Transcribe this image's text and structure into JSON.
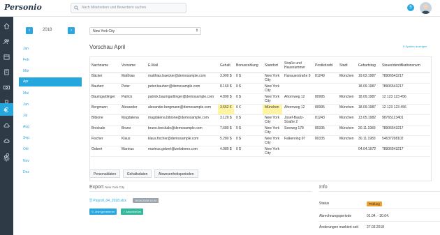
{
  "app": {
    "logo": "Personio",
    "search_placeholder": "Nach Mitarbeitern und Bewerbern suchen",
    "notification_count": "5"
  },
  "sidebar": {
    "icons": [
      "home-icon",
      "users-icon",
      "calendar-icon",
      "building-icon",
      "money-icon",
      "trophy-icon",
      "euro-icon",
      "cloud-upload-icon",
      "cloud-icon",
      "link-icon",
      "gear-icon"
    ],
    "active": "euro-icon"
  },
  "period": {
    "year": "2018",
    "prev_label": "‹",
    "next_label": "›",
    "months": [
      "Jan",
      "Feb",
      "Mär",
      "Apr",
      "Mai",
      "Jun",
      "Jul",
      "Aug",
      "Sep",
      "Okt",
      "Nov",
      "Dez"
    ],
    "active_month": "Apr"
  },
  "main": {
    "location_select": "New York City",
    "preview_title": "Vorschau April",
    "hide_columns_link": "5 Spalten anzeigen",
    "columns": [
      "Nachname",
      "Vorname",
      "E-Mail",
      "Gehalt",
      "Bonuszahlung",
      "Standort",
      "Straße und Hausnummer",
      "Postleitzahl",
      "Stadt",
      "Geburtstag",
      "Steueridentifikationsnum"
    ],
    "rows": [
      [
        "Bäcker",
        "Matthias",
        "matthias.baecker@demosample.com",
        "3.900 $",
        "0 $",
        "New York City",
        "Hanauerstraße 9",
        "81249",
        "München",
        "19.03.1987",
        "78906543217"
      ],
      [
        "Bauherr",
        "Peter",
        "peter.bauherr@demosample.com",
        "8.160 $",
        "0 $",
        "New York City",
        "",
        "",
        "",
        "18.09.1987",
        "78906543217"
      ],
      [
        "Baumgartlinger",
        "Patrick",
        "patrick.baumgartlinger@demosample.com",
        "4.800 $",
        "0 $",
        "New York City",
        "Ahornweg 12",
        "80995",
        "München",
        "18.09.1987",
        "12 123 123 456"
      ],
      [
        "Bergmann",
        "Alexander",
        "alexander.bergmann@demosample.com",
        "3.552 €",
        "0 €",
        "München",
        "Ahornweg 12",
        "80995",
        "München",
        "18.09.1987",
        "12 123 123 456"
      ],
      [
        "Bibione",
        "Magdalena",
        "magdalena.bibione@demosample.com",
        "3.120 $",
        "0 $",
        "New York City",
        "Josef-Bautz-Straße 2",
        "81243",
        "München",
        "13.05.1982",
        "98765123401"
      ],
      [
        "Breckalo",
        "Bruno",
        "bruno.breckalo@demosample.com",
        "7.680 $",
        "0 $",
        "New York City",
        "Seeweg 178",
        "80335",
        "München",
        "20.11.1983",
        "78906543217"
      ],
      [
        "Fischer",
        "Klaus",
        "klaus.fischer@demosample.com",
        "5.280 $",
        "0 $",
        "New York City",
        "Falkenring 97",
        "80335",
        "München",
        "30.11.1983",
        "54637298102"
      ],
      [
        "Gebert",
        "Marinus",
        "marinus.gebert@webdemo.com",
        "4.080 $",
        "0 $",
        "New York City",
        "",
        "",
        "",
        "04.04.1972",
        "78906543217"
      ]
    ],
    "tabs": [
      "Personaldaten",
      "Gehaltsdaten",
      "Abwesenheitsperioden"
    ]
  },
  "export": {
    "title": "Export",
    "subtitle": "New York City",
    "file_name": "Payroll_04_2018.xlsx",
    "file_date": "19.04.2018 14:34",
    "btn_generate": "Jetzt generieren",
    "btn_finalize": "Abschließen"
  },
  "info": {
    "title": "Info",
    "status_label": "Status",
    "status_value": "Prüfung",
    "period_label": "Abrechnungsperiode",
    "period_value": "01.04. - 30.04.",
    "changes_label": "Änderungen markiert seit",
    "changes_value": "27.03.2018"
  }
}
